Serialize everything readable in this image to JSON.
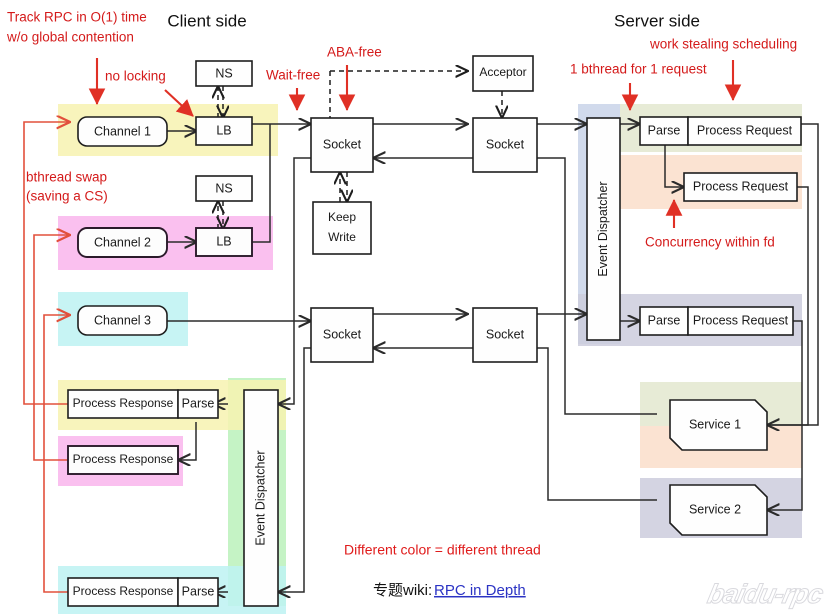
{
  "headings": {
    "client": "Client side",
    "server": "Server side"
  },
  "annotations": {
    "track_rpc_l1": "Track RPC in O(1) time",
    "track_rpc_l2": "w/o global contention",
    "no_locking": "no locking",
    "wait_free": "Wait-free",
    "aba_free": "ABA-free",
    "one_bthread": "1 bthread for 1 request",
    "work_stealing": "work stealing scheduling",
    "concurrency_fd": "Concurrency within fd",
    "bthread_swap_l1": "bthread swap",
    "bthread_swap_l2": "(saving a CS)"
  },
  "nodes": {
    "channel1": "Channel 1",
    "channel2": "Channel 2",
    "channel3": "Channel 3",
    "lb1": "LB",
    "lb2": "LB",
    "ns1": "NS",
    "ns2": "NS",
    "socket_c1": "Socket",
    "socket_c2": "Socket",
    "socket_s1": "Socket",
    "socket_s2": "Socket",
    "keep_write_l1": "Keep",
    "keep_write_l2": "Write",
    "acceptor": "Acceptor",
    "event_dispatcher_server": "Event Dispatcher",
    "event_dispatcher_client": "Event Dispatcher",
    "parse_s1": "Parse",
    "process_request_1": "Process Request",
    "process_request_2": "Process Request",
    "parse_s2": "Parse",
    "process_request_3": "Process Request",
    "service1": "Service 1",
    "service2": "Service 2",
    "process_response_1": "Process Response",
    "parse_c1": "Parse",
    "process_response_2": "Process Response",
    "process_response_3": "Process Response",
    "parse_c3": "Parse"
  },
  "footer": {
    "legend": "Different color = different thread",
    "wiki_label": "专题wiki:",
    "wiki_link": "RPC in Depth",
    "watermark": "baidu-rpc"
  },
  "colors": {
    "yellow": "#f7f2b0",
    "magenta": "#f9b5ec",
    "cyan": "#bdf2f2",
    "green": "#b6f0b6",
    "blue_gray": "#ccd6ea",
    "olive": "#e4e9d2",
    "peach": "#fbe0cd",
    "lavender": "#ccccdd",
    "red_accent": "#d41a1a",
    "link": "#2b33c4",
    "edge": "#2b2b2b"
  }
}
